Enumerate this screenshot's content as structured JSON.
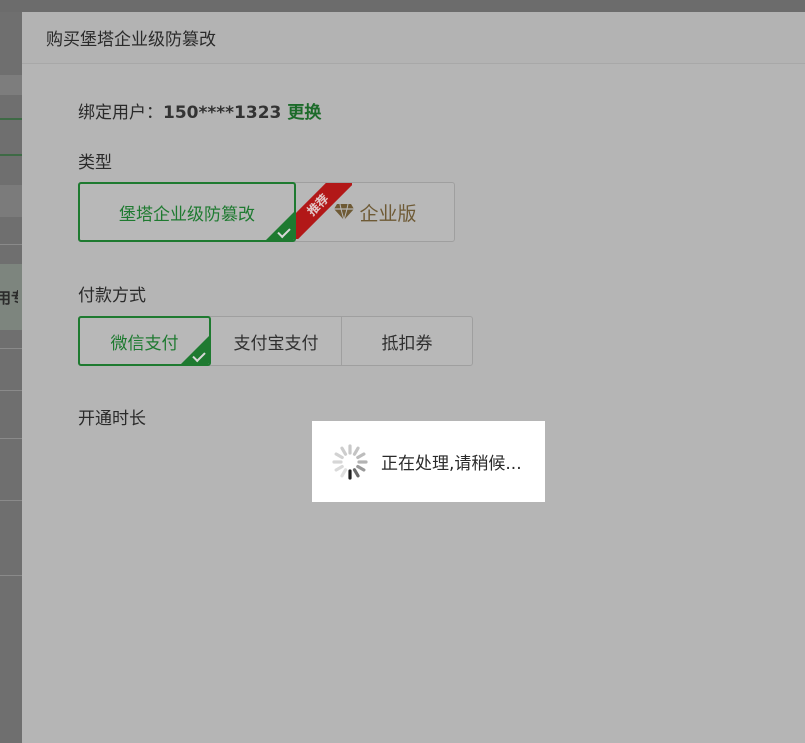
{
  "modal": {
    "title": "购买堡塔企业级防篡改"
  },
  "bind": {
    "label": "绑定用户：",
    "phone": "150****1323",
    "change_label": "更换"
  },
  "type_section": {
    "label": "类型",
    "options": [
      {
        "label": "堡塔企业级防篡改",
        "selected": true
      },
      {
        "label": "企业版",
        "selected": false,
        "ribbon": "推荐"
      }
    ]
  },
  "payment_section": {
    "label": "付款方式",
    "options": [
      {
        "label": "微信支付",
        "selected": true
      },
      {
        "label": "支付宝支付",
        "selected": false
      },
      {
        "label": "抵扣券",
        "selected": false
      }
    ]
  },
  "duration_section": {
    "label": "开通时长"
  },
  "loading": {
    "text": "正在处理,请稍候..."
  },
  "background": {
    "fragment_text": "用专"
  },
  "colors": {
    "accent_green": "#1e7a30",
    "ribbon_red": "#b21818",
    "enterprise_gold": "#6e5a35"
  }
}
